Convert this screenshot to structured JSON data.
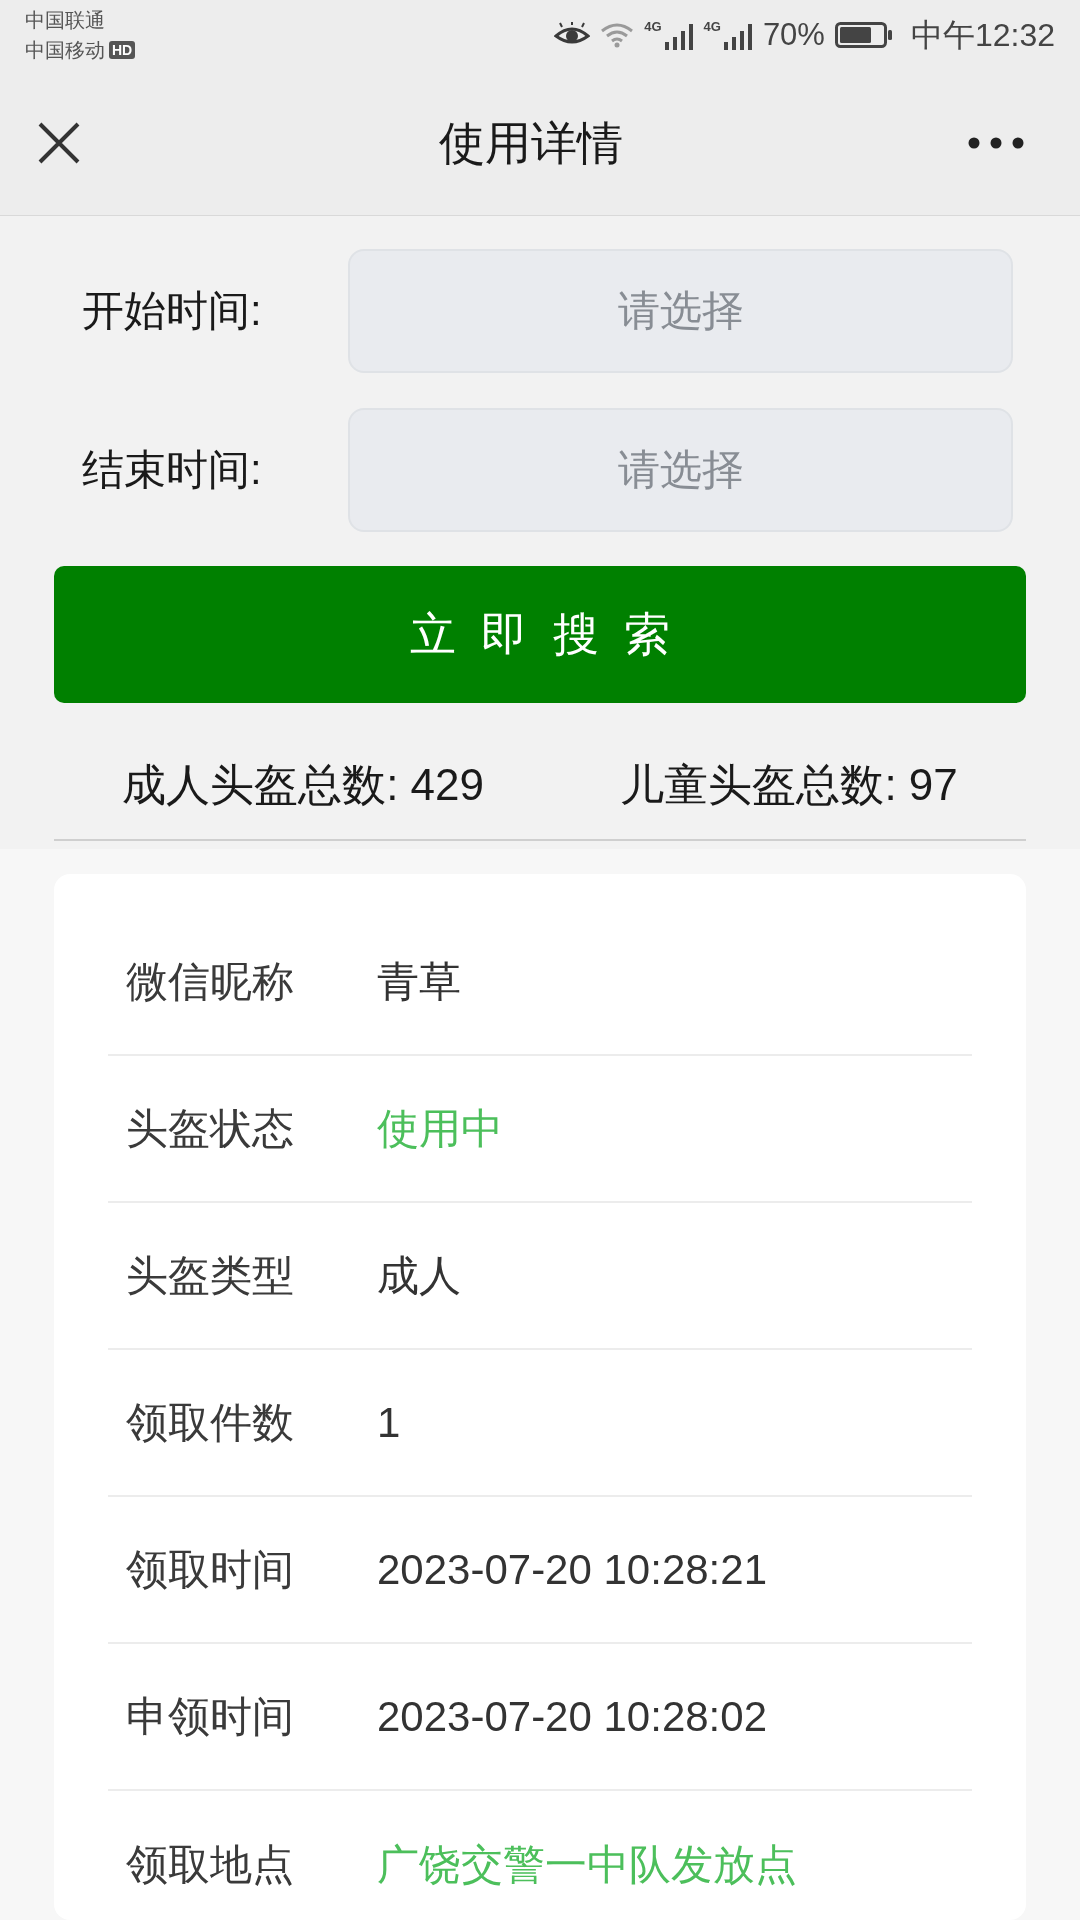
{
  "status_bar": {
    "carriers": [
      {
        "name": "中国联通"
      },
      {
        "name": "中国移动",
        "badge": "HD"
      }
    ],
    "signals": [
      {
        "network": "4G"
      },
      {
        "network": "4G"
      }
    ],
    "battery": "70%",
    "time": "中午12:32"
  },
  "nav": {
    "title": "使用详情"
  },
  "filters": [
    {
      "label": "开始时间:",
      "placeholder": "请选择"
    },
    {
      "label": "结束时间:",
      "placeholder": "请选择"
    }
  ],
  "search_button": "立即搜索",
  "totals": [
    "成人头盔总数: 429",
    "儿童头盔总数: 97"
  ],
  "details": [
    {
      "label": "微信昵称",
      "value": "青草",
      "color": "#333333"
    },
    {
      "label": "头盔状态",
      "value": "使用中",
      "color": "#4cbf5b"
    },
    {
      "label": "头盔类型",
      "value": "成人",
      "color": "#333333"
    },
    {
      "label": "领取件数",
      "value": "1",
      "color": "#333333"
    },
    {
      "label": "领取时间",
      "value": "2023-07-20 10:28:21",
      "color": "#333333"
    },
    {
      "label": "申领时间",
      "value": "2023-07-20 10:28:02",
      "color": "#333333"
    },
    {
      "label": "领取地点",
      "value": "广饶交警一中队发放点",
      "color": "#4cbf5b"
    }
  ]
}
